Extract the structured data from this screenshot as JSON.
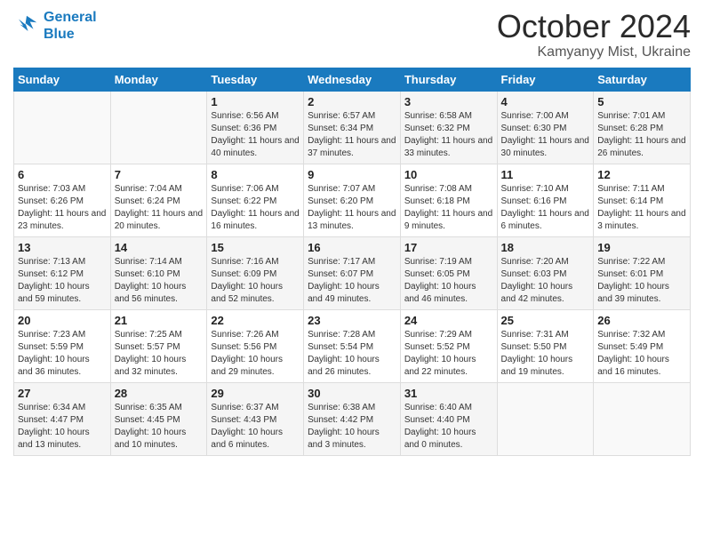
{
  "header": {
    "logo_line1": "General",
    "logo_line2": "Blue",
    "month": "October 2024",
    "location": "Kamyanyy Mist, Ukraine"
  },
  "days_of_week": [
    "Sunday",
    "Monday",
    "Tuesday",
    "Wednesday",
    "Thursday",
    "Friday",
    "Saturday"
  ],
  "weeks": [
    [
      {
        "day": "",
        "content": ""
      },
      {
        "day": "",
        "content": ""
      },
      {
        "day": "1",
        "content": "Sunrise: 6:56 AM\nSunset: 6:36 PM\nDaylight: 11 hours\nand 40 minutes."
      },
      {
        "day": "2",
        "content": "Sunrise: 6:57 AM\nSunset: 6:34 PM\nDaylight: 11 hours\nand 37 minutes."
      },
      {
        "day": "3",
        "content": "Sunrise: 6:58 AM\nSunset: 6:32 PM\nDaylight: 11 hours\nand 33 minutes."
      },
      {
        "day": "4",
        "content": "Sunrise: 7:00 AM\nSunset: 6:30 PM\nDaylight: 11 hours\nand 30 minutes."
      },
      {
        "day": "5",
        "content": "Sunrise: 7:01 AM\nSunset: 6:28 PM\nDaylight: 11 hours\nand 26 minutes."
      }
    ],
    [
      {
        "day": "6",
        "content": "Sunrise: 7:03 AM\nSunset: 6:26 PM\nDaylight: 11 hours\nand 23 minutes."
      },
      {
        "day": "7",
        "content": "Sunrise: 7:04 AM\nSunset: 6:24 PM\nDaylight: 11 hours\nand 20 minutes."
      },
      {
        "day": "8",
        "content": "Sunrise: 7:06 AM\nSunset: 6:22 PM\nDaylight: 11 hours\nand 16 minutes."
      },
      {
        "day": "9",
        "content": "Sunrise: 7:07 AM\nSunset: 6:20 PM\nDaylight: 11 hours\nand 13 minutes."
      },
      {
        "day": "10",
        "content": "Sunrise: 7:08 AM\nSunset: 6:18 PM\nDaylight: 11 hours\nand 9 minutes."
      },
      {
        "day": "11",
        "content": "Sunrise: 7:10 AM\nSunset: 6:16 PM\nDaylight: 11 hours\nand 6 minutes."
      },
      {
        "day": "12",
        "content": "Sunrise: 7:11 AM\nSunset: 6:14 PM\nDaylight: 11 hours\nand 3 minutes."
      }
    ],
    [
      {
        "day": "13",
        "content": "Sunrise: 7:13 AM\nSunset: 6:12 PM\nDaylight: 10 hours\nand 59 minutes."
      },
      {
        "day": "14",
        "content": "Sunrise: 7:14 AM\nSunset: 6:10 PM\nDaylight: 10 hours\nand 56 minutes."
      },
      {
        "day": "15",
        "content": "Sunrise: 7:16 AM\nSunset: 6:09 PM\nDaylight: 10 hours\nand 52 minutes."
      },
      {
        "day": "16",
        "content": "Sunrise: 7:17 AM\nSunset: 6:07 PM\nDaylight: 10 hours\nand 49 minutes."
      },
      {
        "day": "17",
        "content": "Sunrise: 7:19 AM\nSunset: 6:05 PM\nDaylight: 10 hours\nand 46 minutes."
      },
      {
        "day": "18",
        "content": "Sunrise: 7:20 AM\nSunset: 6:03 PM\nDaylight: 10 hours\nand 42 minutes."
      },
      {
        "day": "19",
        "content": "Sunrise: 7:22 AM\nSunset: 6:01 PM\nDaylight: 10 hours\nand 39 minutes."
      }
    ],
    [
      {
        "day": "20",
        "content": "Sunrise: 7:23 AM\nSunset: 5:59 PM\nDaylight: 10 hours\nand 36 minutes."
      },
      {
        "day": "21",
        "content": "Sunrise: 7:25 AM\nSunset: 5:57 PM\nDaylight: 10 hours\nand 32 minutes."
      },
      {
        "day": "22",
        "content": "Sunrise: 7:26 AM\nSunset: 5:56 PM\nDaylight: 10 hours\nand 29 minutes."
      },
      {
        "day": "23",
        "content": "Sunrise: 7:28 AM\nSunset: 5:54 PM\nDaylight: 10 hours\nand 26 minutes."
      },
      {
        "day": "24",
        "content": "Sunrise: 7:29 AM\nSunset: 5:52 PM\nDaylight: 10 hours\nand 22 minutes."
      },
      {
        "day": "25",
        "content": "Sunrise: 7:31 AM\nSunset: 5:50 PM\nDaylight: 10 hours\nand 19 minutes."
      },
      {
        "day": "26",
        "content": "Sunrise: 7:32 AM\nSunset: 5:49 PM\nDaylight: 10 hours\nand 16 minutes."
      }
    ],
    [
      {
        "day": "27",
        "content": "Sunrise: 6:34 AM\nSunset: 4:47 PM\nDaylight: 10 hours\nand 13 minutes."
      },
      {
        "day": "28",
        "content": "Sunrise: 6:35 AM\nSunset: 4:45 PM\nDaylight: 10 hours\nand 10 minutes."
      },
      {
        "day": "29",
        "content": "Sunrise: 6:37 AM\nSunset: 4:43 PM\nDaylight: 10 hours\nand 6 minutes."
      },
      {
        "day": "30",
        "content": "Sunrise: 6:38 AM\nSunset: 4:42 PM\nDaylight: 10 hours\nand 3 minutes."
      },
      {
        "day": "31",
        "content": "Sunrise: 6:40 AM\nSunset: 4:40 PM\nDaylight: 10 hours\nand 0 minutes."
      },
      {
        "day": "",
        "content": ""
      },
      {
        "day": "",
        "content": ""
      }
    ]
  ]
}
